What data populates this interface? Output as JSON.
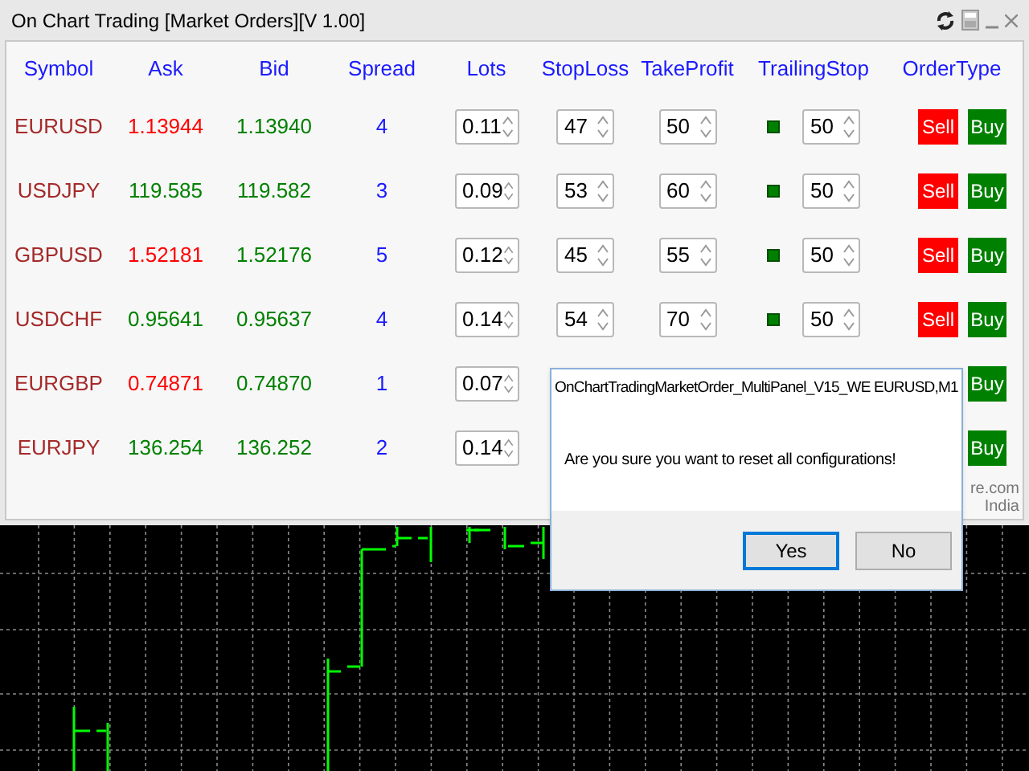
{
  "window": {
    "title": "On Chart Trading [Market Orders][V 1.00]"
  },
  "columns": [
    "Symbol",
    "Ask",
    "Bid",
    "Spread",
    "Lots",
    "StopLoss",
    "TakeProfit",
    "TrailingStop",
    "OrderType"
  ],
  "rows": [
    {
      "symbol": "EURUSD",
      "ask": {
        "text": "1.13944",
        "color": "#ff0000"
      },
      "bid": "1.13940",
      "spread": "4",
      "lots": "0.11",
      "stop_loss": "47",
      "take_profit": "50",
      "trailing_on": true,
      "trailing_stop": "50",
      "sell": "Sell",
      "buy": "Buy"
    },
    {
      "symbol": "USDJPY",
      "ask": {
        "text": "119.585",
        "color": "#008000"
      },
      "bid": "119.582",
      "spread": "3",
      "lots": "0.09",
      "stop_loss": "53",
      "take_profit": "60",
      "trailing_on": true,
      "trailing_stop": "50",
      "sell": "Sell",
      "buy": "Buy"
    },
    {
      "symbol": "GBPUSD",
      "ask": {
        "text": "1.52181",
        "color": "#ff0000"
      },
      "bid": "1.52176",
      "spread": "5",
      "lots": "0.12",
      "stop_loss": "45",
      "take_profit": "55",
      "trailing_on": true,
      "trailing_stop": "50",
      "sell": "Sell",
      "buy": "Buy"
    },
    {
      "symbol": "USDCHF",
      "ask": {
        "text": "0.95641",
        "color": "#008000"
      },
      "bid": "0.95637",
      "spread": "4",
      "lots": "0.14",
      "stop_loss": "54",
      "take_profit": "70",
      "trailing_on": true,
      "trailing_stop": "50",
      "sell": "Sell",
      "buy": "Buy"
    },
    {
      "symbol": "EURGBP",
      "ask": {
        "text": "0.74871",
        "color": "#ff0000"
      },
      "bid": "0.74870",
      "spread": "1",
      "lots": "0.07",
      "buy": "Buy"
    },
    {
      "symbol": "EURJPY",
      "ask": {
        "text": "136.254",
        "color": "#008000"
      },
      "bid": "136.252",
      "spread": "2",
      "lots": "0.14",
      "buy": "Buy"
    }
  ],
  "footer_lines": [
    "re.com",
    "India"
  ],
  "dialog": {
    "title": "OnChartTradingMarketOrder_MultiPanel_V15_WE EURUSD,M1",
    "message": "Are you sure you want to reset all configurations!",
    "buttons": [
      {
        "label": "Yes",
        "focused": true
      },
      {
        "label": "No",
        "focused": false
      }
    ]
  }
}
